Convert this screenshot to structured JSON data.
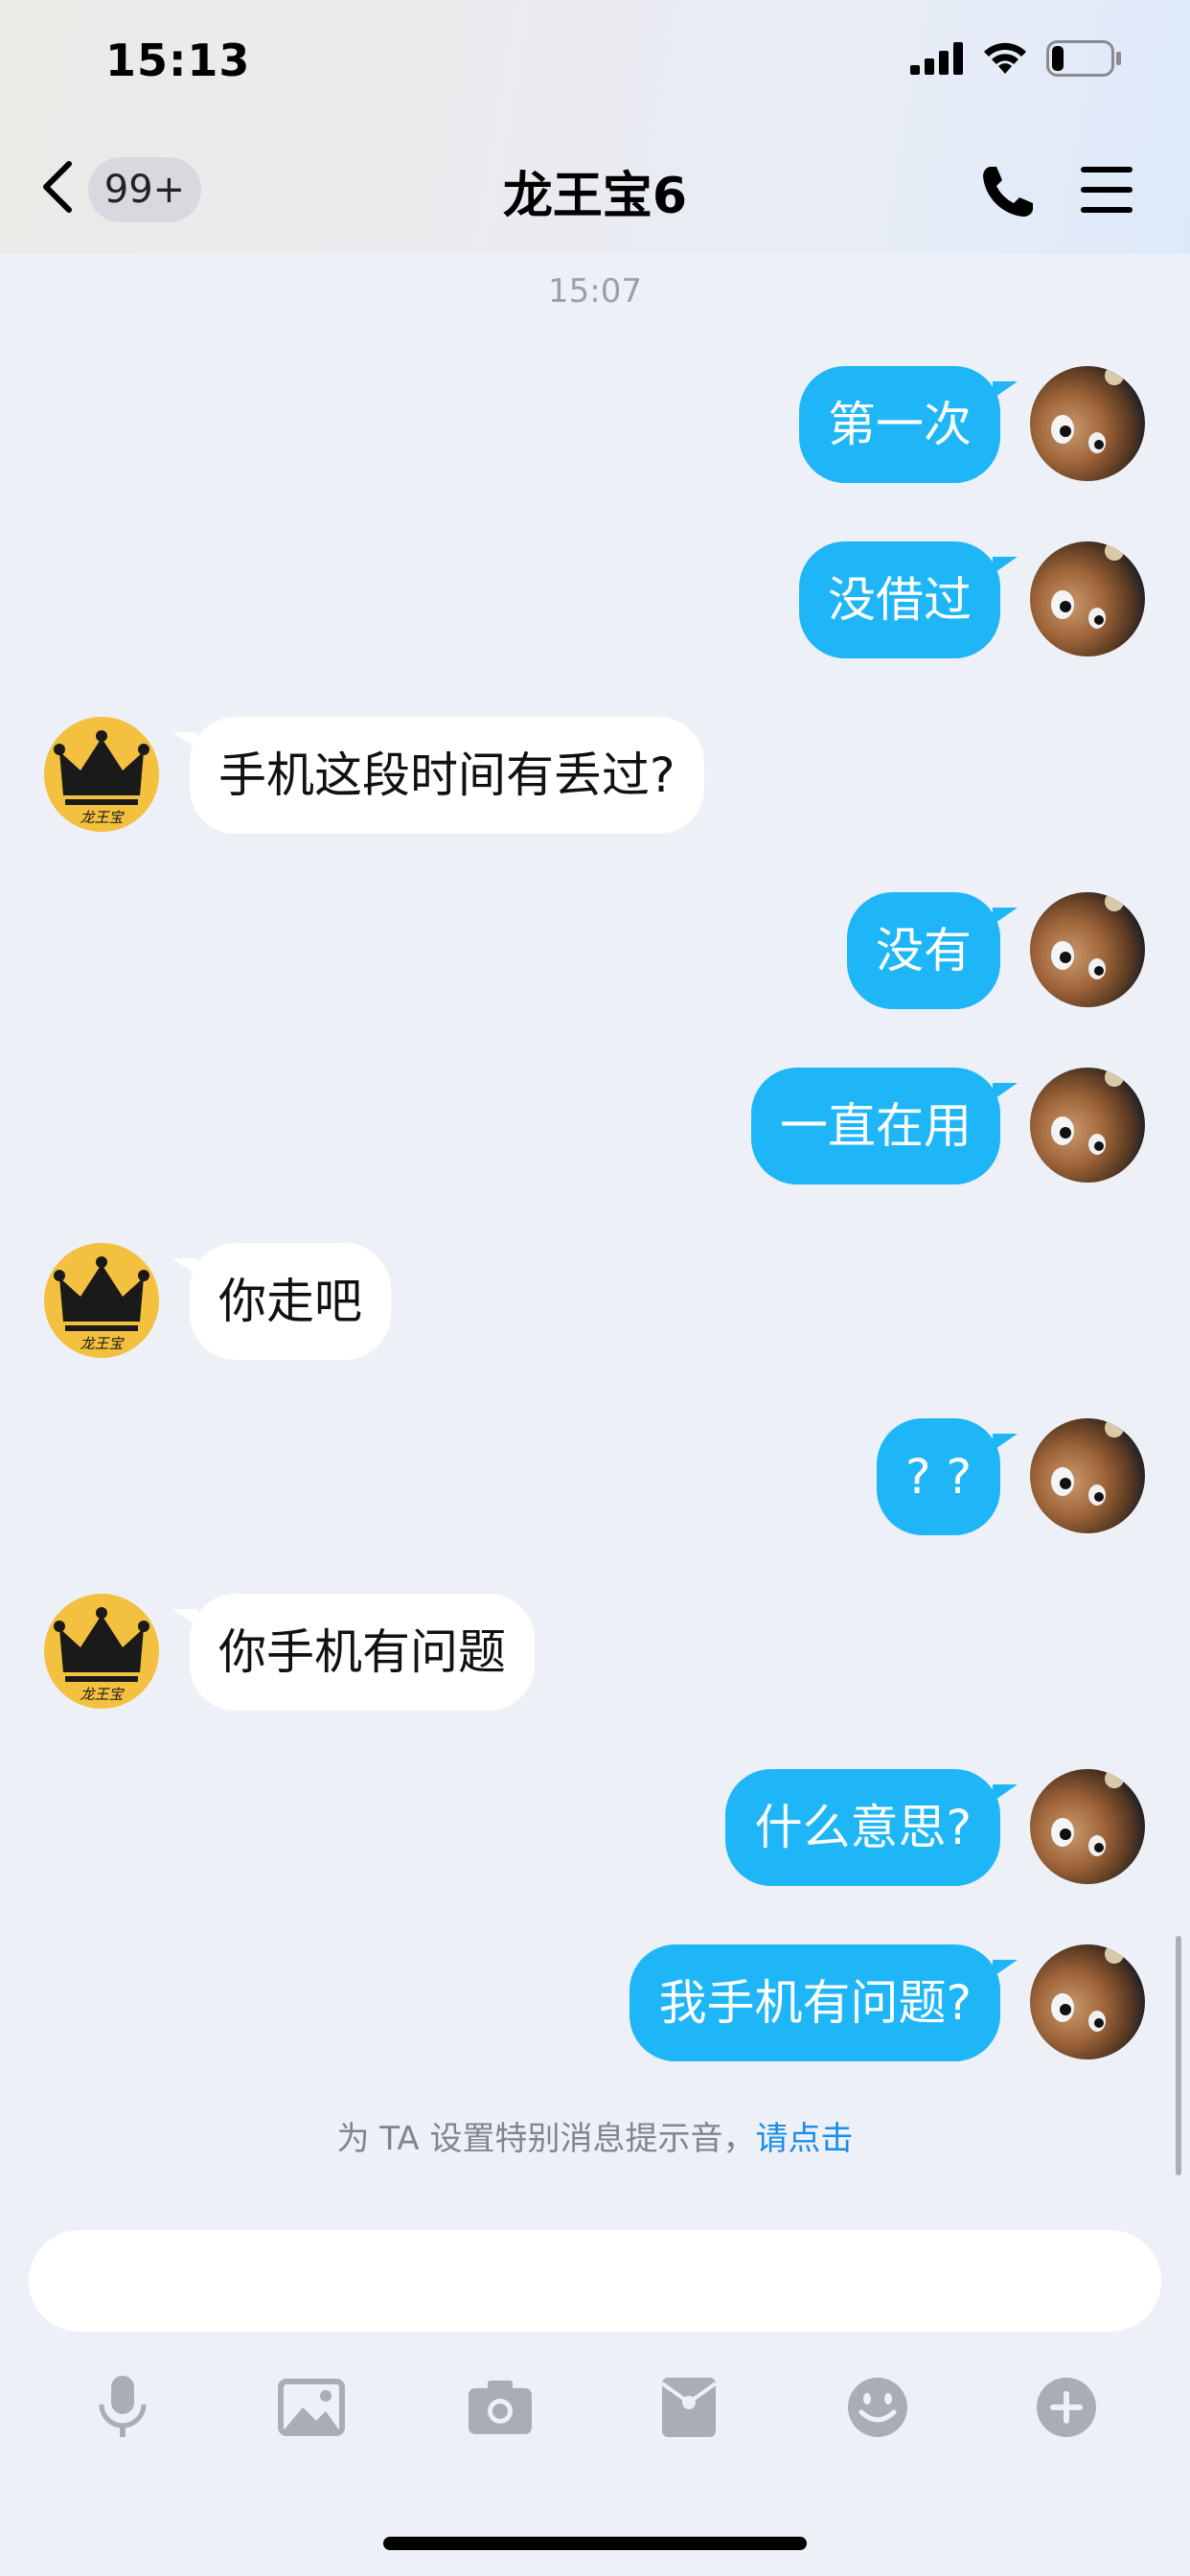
{
  "status_bar": {
    "time": "15:13",
    "battery_level": 0.2
  },
  "header": {
    "unread_badge": "99+",
    "title": "龙王宝6"
  },
  "conversation": {
    "time_divider": "15:07",
    "messages": [
      {
        "sender": "me",
        "text": "第一次"
      },
      {
        "sender": "me",
        "text": "没借过"
      },
      {
        "sender": "them",
        "text": "手机这段时间有丢过?"
      },
      {
        "sender": "me",
        "text": "没有"
      },
      {
        "sender": "me",
        "text": "一直在用"
      },
      {
        "sender": "them",
        "text": "你走吧"
      },
      {
        "sender": "me",
        "text": "? ?"
      },
      {
        "sender": "them",
        "text": "你手机有问题"
      },
      {
        "sender": "me",
        "text": "什么意思?"
      },
      {
        "sender": "me",
        "text": "我手机有问题?"
      }
    ],
    "other_avatar_logo_text": "龙王宝"
  },
  "hint": {
    "text": "为 TA 设置特别消息提示音，",
    "link": "请点击"
  },
  "composer": {
    "value": "",
    "placeholder": ""
  },
  "toolbar": {
    "icons": [
      "microphone-icon",
      "image-icon",
      "camera-icon",
      "red-packet-icon",
      "emoji-icon",
      "plus-icon"
    ]
  },
  "colors": {
    "my_bubble": "#1fb6f7",
    "their_bubble": "#ffffff",
    "background": "#edf0f7",
    "link": "#1a8ee6",
    "toolbar_icon": "#a8adb7"
  }
}
